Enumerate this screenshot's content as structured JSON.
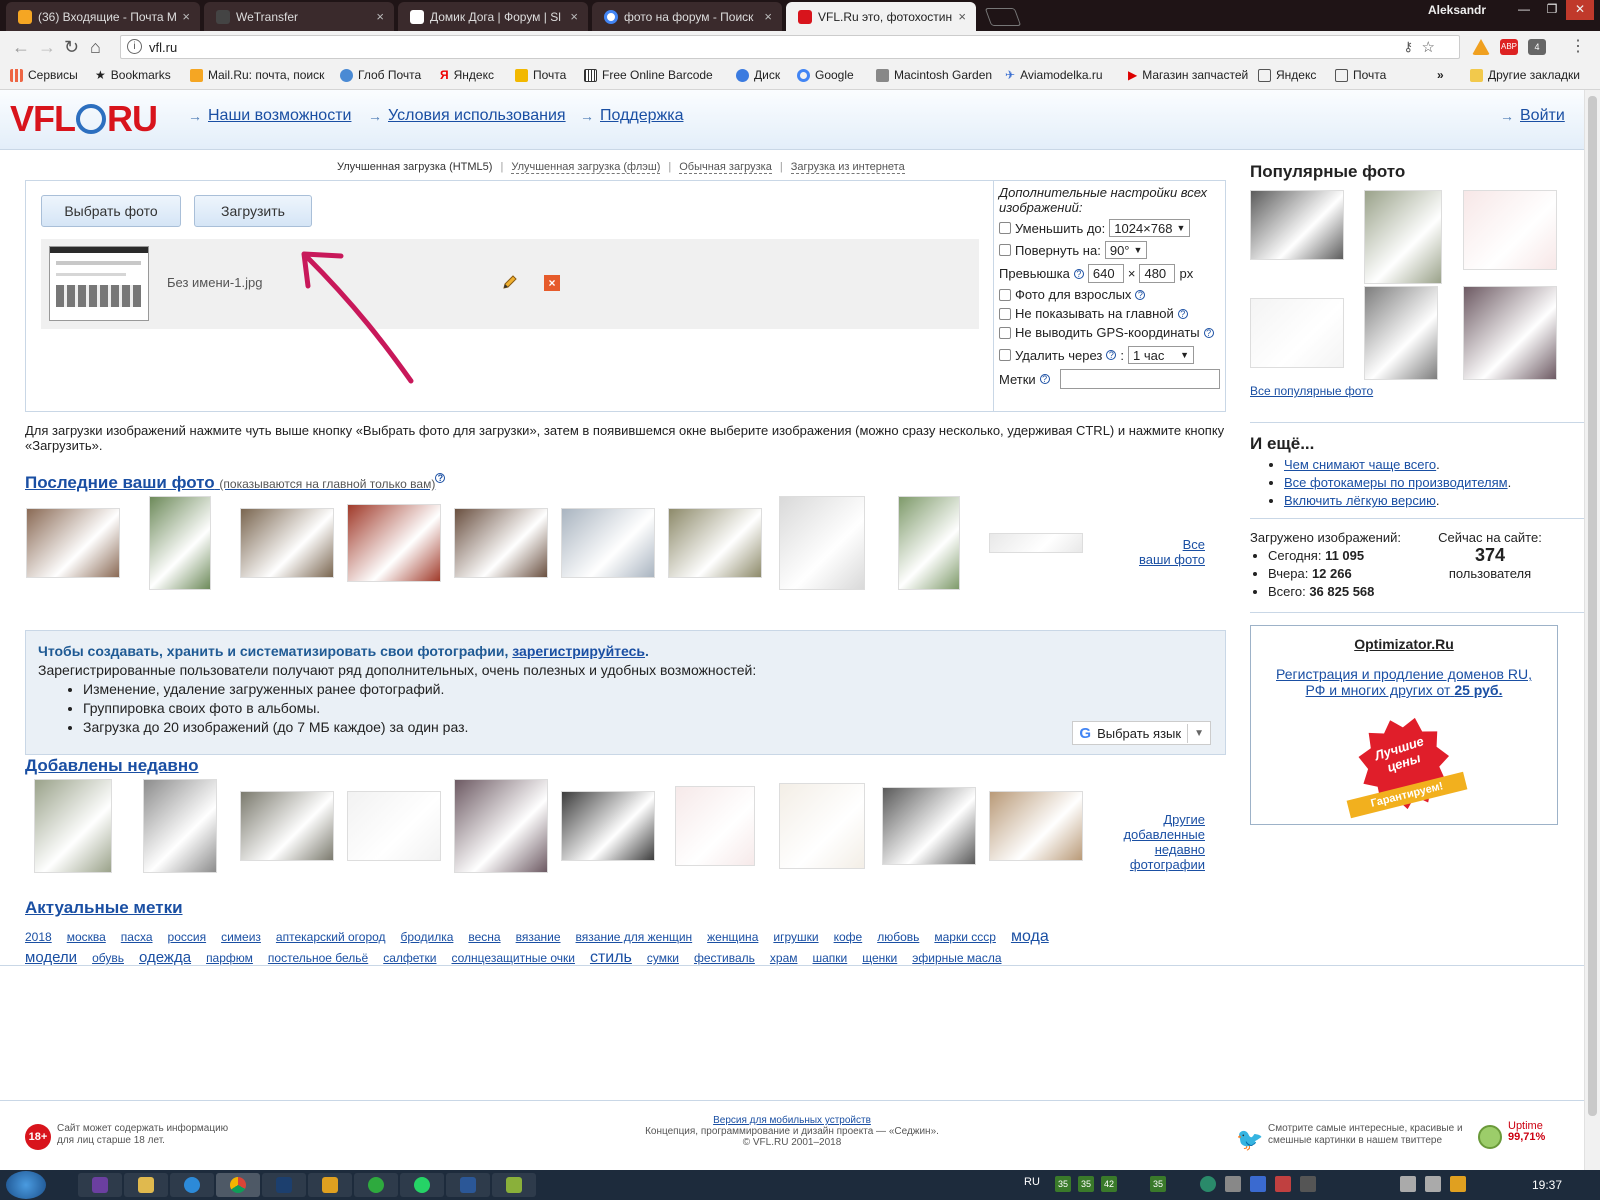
{
  "browser": {
    "tabs": [
      {
        "title": "(36) Входящие - Почта M",
        "favicon_color": "#f5a623"
      },
      {
        "title": "WeTransfer",
        "favicon_color": "#444444"
      },
      {
        "title": "Домик Дога | Форум | Sl",
        "favicon_color": "#ffffff"
      },
      {
        "title": "фото на форум - Поиск",
        "favicon_color": "#4285f4"
      },
      {
        "title": "VFL.Ru это, фотохостинг",
        "favicon_color": "#d8141c"
      }
    ],
    "close_glyph": "×",
    "user_name": "Aleksandr",
    "window_buttons": [
      "—",
      "❐",
      "✕"
    ],
    "url": "vfl.ru",
    "extensions": [
      "ABP",
      "4"
    ],
    "bookmarks": [
      {
        "label": "Сервисы",
        "icon": "apps-icon"
      },
      {
        "label": "Bookmarks",
        "icon": "star-icon"
      },
      {
        "label": "Mail.Ru: почта, поиск",
        "icon": "mailru-icon"
      },
      {
        "label": "Глоб Почта",
        "icon": "globe-icon"
      },
      {
        "label": "Яндекс",
        "icon": "yandex-icon"
      },
      {
        "label": "Почта",
        "icon": "mail-icon"
      },
      {
        "label": "Free Online Barcode",
        "icon": "barcode-icon"
      },
      {
        "label": "Диск",
        "icon": "disk-icon"
      },
      {
        "label": "Google",
        "icon": "google-icon"
      },
      {
        "label": "Macintosh Garden",
        "icon": "page-icon"
      },
      {
        "label": "Aviamodelka.ru",
        "icon": "plane-icon"
      },
      {
        "label": "Магазин запчастей",
        "icon": "shop-icon"
      },
      {
        "label": "Яндекс",
        "icon": "yandex-icon"
      },
      {
        "label": "Почта",
        "icon": "page-icon"
      }
    ],
    "bookmarks_more": "»",
    "other_bookmarks": "Другие закладки"
  },
  "site": {
    "logo": {
      "before": "VFL",
      "after": "RU"
    },
    "nav": [
      {
        "label": "Наши возможности"
      },
      {
        "label": "Условия использования"
      },
      {
        "label": "Поддержка"
      }
    ],
    "nav_arrow": "→",
    "login": "Войти"
  },
  "upload": {
    "modes": [
      "Улучшенная загрузка (HTML5)",
      "Улучшенная загрузка (флэш)",
      "Обычная загрузка",
      "Загрузка из интернета"
    ],
    "separator": "|",
    "choose_button": "Выбрать фото",
    "upload_button": "Загрузить",
    "file_name": "Без имени-1.jpg",
    "options": {
      "title": "Дополнительные настройки всех изображений:",
      "reduce_label": "Уменьшить до:",
      "reduce_value": "1024×768",
      "rotate_label": "Повернуть на:",
      "rotate_value": "90°",
      "thumb_label": "Превьюшка",
      "thumb_w": "640",
      "thumb_times": "×",
      "thumb_h": "480",
      "thumb_unit": "px",
      "adult_label": "Фото для взрослых",
      "hide_main_label": "Не показывать на главной",
      "no_gps_label": "Не выводить GPS-координаты",
      "delete_label": "Удалить через",
      "delete_value": "1 час",
      "tags_label": "Метки",
      "help_glyph": "?",
      "dropdown_glyph": "▼"
    }
  },
  "hint": "Для загрузки изображений нажмите чуть выше кнопку «Выбрать фото для загрузки», затем в появившемся окне выберите изображения (можно сразу несколько, удерживая CTRL) и нажмите кнопку «Загрузить».",
  "your_photos": {
    "title": "Последние ваши фото",
    "note": "(показываются на главной только вам)",
    "more_line1": "Все",
    "more_line2": "ваши фото",
    "colors": [
      "#8a6a55",
      "#6d8a5a",
      "#7a6650",
      "#a03a2a",
      "#6a5040",
      "#a9b4c0",
      "#8d8a6a",
      "#d9d9d9",
      "#7e9a6a",
      "#e8e8e8",
      "#c9d4e0"
    ]
  },
  "register": {
    "lead": "Чтобы создавать, хранить и систематизировать свои фотографии,",
    "link": "зарегистрируйтесь",
    "text": "Зарегистрированные пользователи получают ряд дополнительных, очень полезных и удобных возможностей:",
    "items": [
      "Изменение, удаление загруженных ранее фотографий.",
      "Группировка своих фото в альбомы.",
      "Загрузка до 20 изображений (до 7 МБ каждое) за один раз."
    ],
    "lang_select": "Выбрать язык"
  },
  "recent": {
    "title": "Добавлены недавно",
    "more": "Другие добавленные недавно фотографии",
    "colors": [
      "#9aa28a",
      "#8c8c8c",
      "#7b7a6e",
      "#f2f2f2",
      "#6d5a63",
      "#3d3d3d",
      "#f6e9e9",
      "#f3eee6",
      "#5a5a5a",
      "#b99a78",
      "#9cb8cf"
    ]
  },
  "tags": {
    "title": "Актуальные метки",
    "line1": [
      "2018",
      "москва",
      "пасха",
      "россия",
      "симеиз",
      "аптекарский огород",
      "бродилка",
      "весна",
      "вязание",
      "вязание для женщин",
      "женщина",
      "игрушки",
      "кофе",
      "любовь",
      "марки ссср",
      "мода"
    ],
    "line2": [
      "модели",
      "обувь",
      "одежда",
      "парфюм",
      "постельное бельё",
      "салфетки",
      "солнцезащитные очки",
      "стиль",
      "сумки",
      "фестиваль",
      "храм",
      "шапки",
      "щенки",
      "эфирные масла"
    ]
  },
  "sidebar": {
    "popular_title": "Популярные фото",
    "popular_colors": [
      "#5c5c5c",
      "#9aa28a",
      "#f7e7e7",
      "#f4f4f4",
      "#7d7d7d",
      "#6d5a63"
    ],
    "all_popular": "Все популярные фото",
    "more_title": "И ещё...",
    "more_links": [
      "Чем снимают чаще всего",
      "Все фотокамеры по производителям",
      "Включить лёгкую версию"
    ],
    "stats_title": "Загружено изображений:",
    "stats": [
      {
        "label": "Сегодня:",
        "value": "11 095"
      },
      {
        "label": "Вчера:",
        "value": "12 266"
      },
      {
        "label": "Всего:",
        "value": "36 825 568"
      }
    ],
    "online_title": "Сейчас на сайте:",
    "online_count": "374",
    "online_unit": "пользователя",
    "ad_title": "Optimizator.Ru",
    "ad_text": "Регистрация и продление доменов RU, РФ и многих других от",
    "ad_price": "25 руб.",
    "ad_badge_line1": "Лучшие",
    "ad_badge_line2": "цены",
    "ad_badge_line3": "Гарантируем!"
  },
  "footer": {
    "age": "18+",
    "age_text": "Сайт может содержать информацию для лиц старше 18 лет.",
    "mobile": "Версия для мобильных устройств",
    "concept": "Концепция, программирование и дизайн проекта — «Седжин».",
    "copyright": "© VFL.RU 2001–2018",
    "twitter": "Смотрите самые интересные, красивые и смешные картинки в нашем твиттере",
    "uptime_label": "Uptime",
    "uptime_value": "99,71%"
  },
  "taskbar": {
    "lang": "RU",
    "time": "19:37",
    "tray": [
      "35",
      "35",
      "42",
      "35"
    ]
  },
  "colors": {
    "brand_red": "#d8141c",
    "link": "#1a4fa3",
    "annotation": "#c8185a"
  }
}
